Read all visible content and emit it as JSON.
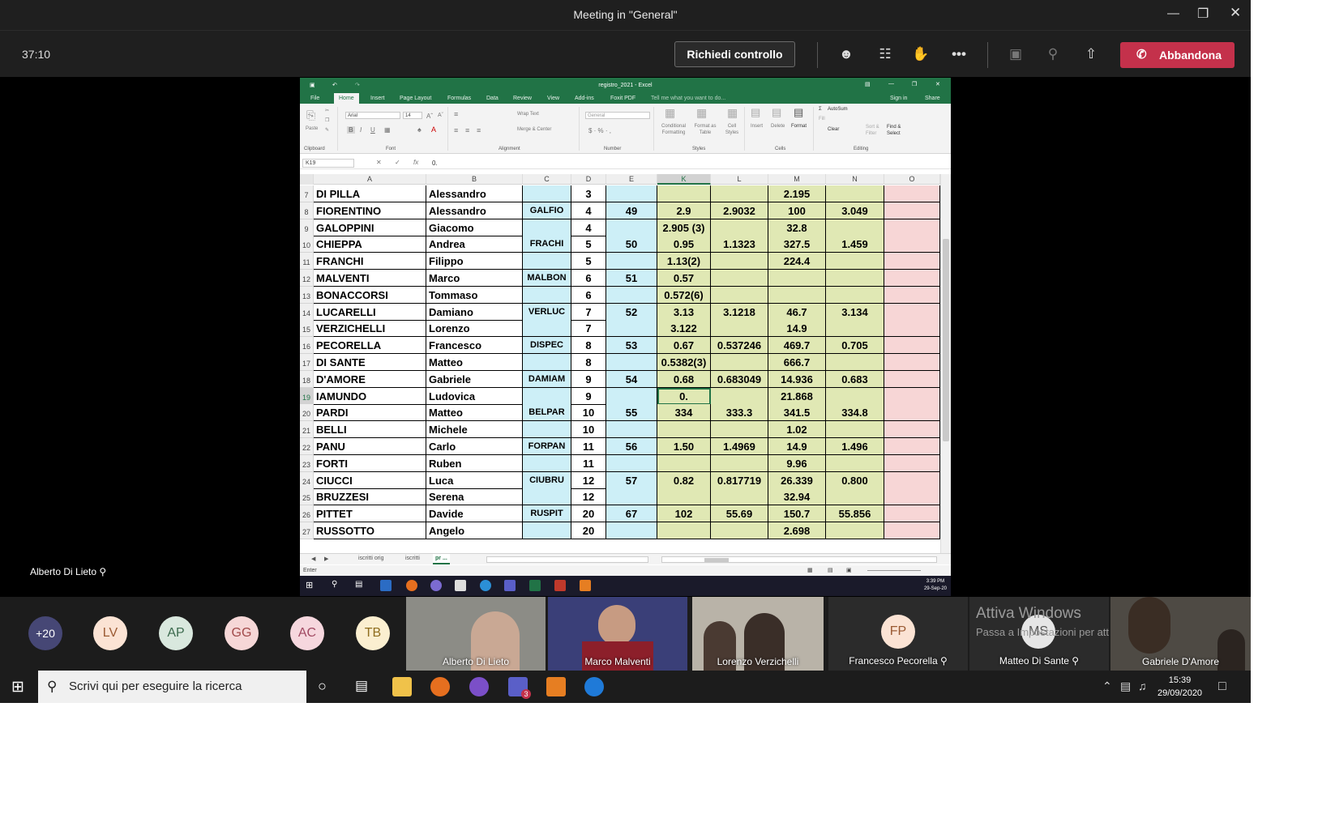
{
  "teams": {
    "meeting_title": "Meeting in \"General\"",
    "timer": "37:10",
    "request_control": "Richiedi controllo",
    "leave_label": "Abbandona",
    "presenter_name": "Alberto Di Lieto"
  },
  "excel": {
    "file_title": "registro_2021 - Excel",
    "tabs": [
      "File",
      "Home",
      "Insert",
      "Page Layout",
      "Formulas",
      "Data",
      "Review",
      "View",
      "Add-ins",
      "Foxit PDF"
    ],
    "tell_me": "Tell me what you want to do...",
    "sign_in": "Sign in",
    "share": "Share",
    "ribbon": {
      "font_name": "Arial",
      "font_size": "14",
      "number_format": "General",
      "wrap_text": "Wrap Text",
      "merge_center": "Merge & Center",
      "conditional_formatting": "Conditional Formatting",
      "format_as_table": "Format as Table",
      "cell_styles": "Cell Styles",
      "insert": "Insert",
      "delete": "Delete",
      "format": "Format",
      "autosum": "AutoSum",
      "fill": "Fill",
      "clear": "Clear",
      "sort_filter": "Sort & Filter",
      "find_select": "Find & Select",
      "paste": "Paste",
      "groups": [
        "Clipboard",
        "Font",
        "Alignment",
        "Number",
        "Styles",
        "Cells",
        "Editing"
      ]
    },
    "name_box": "K19",
    "formula": "0.",
    "columns": [
      "A",
      "B",
      "C",
      "D",
      "E",
      "K",
      "L",
      "M",
      "N",
      "O"
    ],
    "rows": [
      {
        "n": "7",
        "a": "DI PILLA",
        "b": "Alessandro",
        "c": "",
        "d": "3",
        "e": "",
        "k": "",
        "l": "",
        "m": "2.195",
        "nn": ""
      },
      {
        "n": "8",
        "a": "FIORENTINO",
        "b": "Alessandro",
        "c": "GALFIO",
        "d": "4",
        "e": "49",
        "k": "2.9",
        "l": "2.9032",
        "m": "100",
        "nn": "3.049"
      },
      {
        "n": "9",
        "a": "GALOPPINI",
        "b": "Giacomo",
        "c": "",
        "d": "4",
        "e": "",
        "k": "2.905 (3)",
        "l": "",
        "m": "32.8",
        "nn": ""
      },
      {
        "n": "10",
        "a": "CHIEPPA",
        "b": "Andrea",
        "c": "FRACHI",
        "d": "5",
        "e": "50",
        "k": "0.95",
        "l": "1.1323",
        "m": "327.5",
        "nn": "1.459"
      },
      {
        "n": "11",
        "a": "FRANCHI",
        "b": "Filippo",
        "c": "",
        "d": "5",
        "e": "",
        "k": "1.13(2)",
        "l": "",
        "m": "224.4",
        "nn": ""
      },
      {
        "n": "12",
        "a": "MALVENTI",
        "b": "Marco",
        "c": "MALBON",
        "d": "6",
        "e": "51",
        "k": "0.57",
        "l": "",
        "m": "",
        "nn": ""
      },
      {
        "n": "13",
        "a": "BONACCORSI",
        "b": "Tommaso",
        "c": "",
        "d": "6",
        "e": "",
        "k": "0.572(6)",
        "l": "",
        "m": "",
        "nn": ""
      },
      {
        "n": "14",
        "a": "LUCARELLI",
        "b": "Damiano",
        "c": "VERLUC",
        "d": "7",
        "e": "52",
        "k": "3.13",
        "l": "3.1218",
        "m": "46.7",
        "nn": "3.134"
      },
      {
        "n": "15",
        "a": "VERZICHELLI",
        "b": "Lorenzo",
        "c": "",
        "d": "7",
        "e": "",
        "k": "3.122",
        "l": "",
        "m": "14.9",
        "nn": ""
      },
      {
        "n": "16",
        "a": "PECORELLA",
        "b": "Francesco",
        "c": "DISPEC",
        "d": "8",
        "e": "53",
        "k": "0.67",
        "l": "0.537246",
        "m": "469.7",
        "nn": "0.705"
      },
      {
        "n": "17",
        "a": "DI SANTE",
        "b": "Matteo",
        "c": "",
        "d": "8",
        "e": "",
        "k": "0.5382(3)",
        "l": "",
        "m": "666.7",
        "nn": ""
      },
      {
        "n": "18",
        "a": "D'AMORE",
        "b": "Gabriele",
        "c": "DAMIAM",
        "d": "9",
        "e": "54",
        "k": "0.68",
        "l": "0.683049",
        "m": "14.936",
        "nn": "0.683"
      },
      {
        "n": "19",
        "a": "IAMUNDO",
        "b": "Ludovica",
        "c": "",
        "d": "9",
        "e": "",
        "k": "0.",
        "l": "",
        "m": "21.868",
        "nn": ""
      },
      {
        "n": "20",
        "a": "PARDI",
        "b": "Matteo",
        "c": "BELPAR",
        "d": "10",
        "e": "55",
        "k": "334",
        "l": "333.3",
        "m": "341.5",
        "nn": "334.8"
      },
      {
        "n": "21",
        "a": "BELLI",
        "b": "Michele",
        "c": "",
        "d": "10",
        "e": "",
        "k": "",
        "l": "",
        "m": "1.02",
        "nn": ""
      },
      {
        "n": "22",
        "a": "PANU",
        "b": "Carlo",
        "c": "FORPAN",
        "d": "11",
        "e": "56",
        "k": "1.50",
        "l": "1.4969",
        "m": "14.9",
        "nn": "1.496"
      },
      {
        "n": "23",
        "a": "FORTI",
        "b": "Ruben",
        "c": "",
        "d": "11",
        "e": "",
        "k": "",
        "l": "",
        "m": "9.96",
        "nn": ""
      },
      {
        "n": "24",
        "a": "CIUCCI",
        "b": "Luca",
        "c": "CIUBRU",
        "d": "12",
        "e": "57",
        "k": "0.82",
        "l": "0.817719",
        "m": "26.339",
        "nn": "0.800"
      },
      {
        "n": "25",
        "a": "BRUZZESI",
        "b": "Serena",
        "c": "",
        "d": "12",
        "e": "",
        "k": "",
        "l": "",
        "m": "32.94",
        "nn": ""
      },
      {
        "n": "26",
        "a": "PITTET",
        "b": "Davide",
        "c": "RUSPIT",
        "d": "20",
        "e": "67",
        "k": "102",
        "l": "55.69",
        "m": "150.7",
        "nn": "55.856"
      },
      {
        "n": "27",
        "a": "RUSSOTTO",
        "b": "Angelo",
        "c": "",
        "d": "20",
        "e": "",
        "k": "",
        "l": "",
        "m": "2.698",
        "nn": ""
      }
    ],
    "sheet_tabs": [
      "iscritti orig",
      "iscritti",
      "pr ..."
    ],
    "status_mode": "Enter",
    "taskbar_time": "3:39 PM",
    "taskbar_date": "29-Sep-20"
  },
  "participants": {
    "overflow": "+20",
    "avatars": [
      {
        "initials": "LV",
        "bg": "#fbe3d4",
        "fg": "#9a5a33"
      },
      {
        "initials": "AP",
        "bg": "#d9e8de",
        "fg": "#3d6b4f"
      },
      {
        "initials": "GG",
        "bg": "#f6d7d7",
        "fg": "#a14a4a"
      },
      {
        "initials": "AC",
        "bg": "#f6d7de",
        "fg": "#a14a63"
      },
      {
        "initials": "TB",
        "bg": "#fbefd0",
        "fg": "#8f6e1f"
      }
    ],
    "video_tiles": [
      "Alberto Di Lieto",
      "Marco Malventi",
      "Lorenzo Verzichelli"
    ],
    "fp_initials": "FP",
    "fp_name": "Francesco Pecorella",
    "ms_initials": "MS",
    "ms_name": "Matteo Di Sante",
    "last_name": "Gabriele D'Amore",
    "watermark_title": "Attiva Windows",
    "watermark_sub": "Passa a Impostazioni per attivare Windows."
  },
  "windows": {
    "search_placeholder": "Scrivi qui per eseguire la ricerca",
    "time": "15:39",
    "date": "29/09/2020",
    "teams_badge": "3"
  }
}
